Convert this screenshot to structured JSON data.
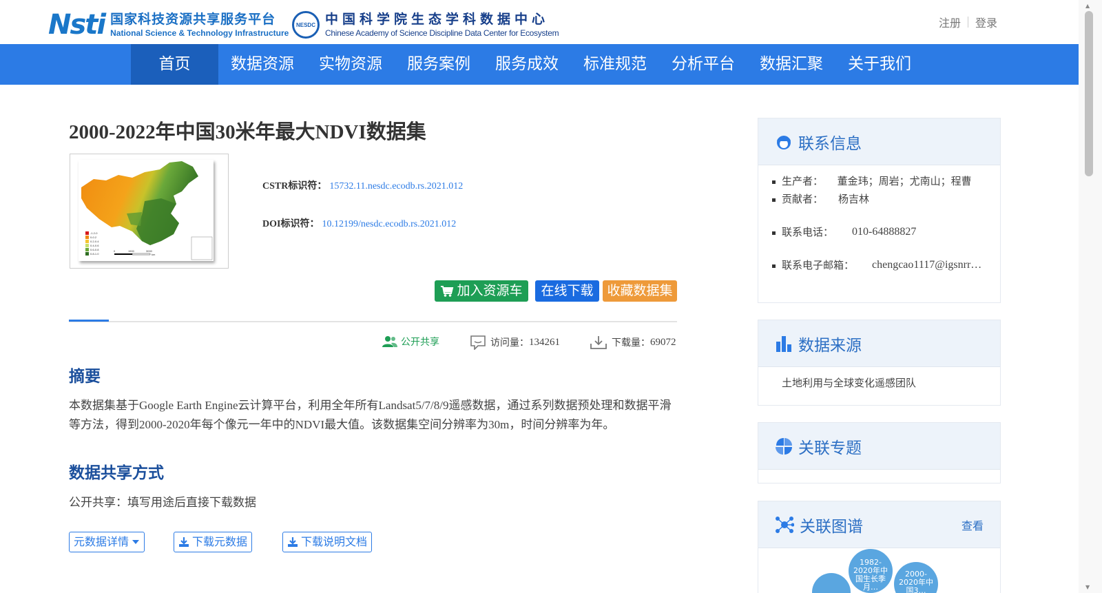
{
  "header": {
    "logo1": {
      "mark": "Nsti",
      "cn": "国家科技资源共享服务平台",
      "en": "National Science & Technology Infrastructure"
    },
    "logo2": {
      "badge": "NESDC",
      "cn": "中国科学院生态学科数据中心",
      "en": "Chinese Academy of Science Discipline Data Center for Ecosystem"
    },
    "register": "注册",
    "login": "登录"
  },
  "nav": {
    "items": [
      "首页",
      "数据资源",
      "实物资源",
      "服务案例",
      "服务成效",
      "标准规范",
      "分析平台",
      "数据汇聚",
      "关于我们"
    ],
    "active_index": 0
  },
  "dataset": {
    "title": "2000-2022年中国30米年最大NDVI数据集",
    "cstr_label": "CSTR标识符：",
    "cstr_value": "15732.11.nesdc.ecodb.rs.2021.012",
    "doi_label": "DOI标识符：",
    "doi_value": "10.12199/nesdc.ecodb.rs.2021.012",
    "thumbnail_legend": [
      "-1.2-0",
      "0-0.2",
      "0.2-0.4",
      "0.4-0.6",
      "0.6-0.8",
      "0.8-1.0"
    ],
    "thumbnail_scale": [
      "0",
      "1500",
      "3000",
      "km"
    ]
  },
  "actions": {
    "add_cart": "加入资源车",
    "download_online": "在线下载",
    "favorite": "收藏数据集"
  },
  "stats": {
    "share_label": "公开共享",
    "views_label": "访问量：",
    "views": "134261",
    "downloads_label": "下载量：",
    "downloads": "69072"
  },
  "abstract": {
    "heading": "摘要",
    "text": "本数据集基于Google Earth Engine云计算平台，利用全年所有Landsat5/7/8/9遥感数据，通过系列数据预处理和数据平滑等方法，得到2000-2020年每个像元一年中的NDVI最大值。该数据集空间分辨率为30m，时间分辨率为年。"
  },
  "sharing": {
    "heading": "数据共享方式",
    "text": "公开共享：填写用途后直接下载数据"
  },
  "doc_buttons": {
    "metadata_detail": "元数据详情",
    "download_metadata": "下载元数据",
    "download_doc": "下载说明文档"
  },
  "sidebar": {
    "contact": {
      "title": "联系信息",
      "producer_label": "生产者：",
      "producer": "董金玮；周岩；尤南山；程曹",
      "contributor_label": "贡献者：",
      "contributor": "杨吉林",
      "phone_label": "联系电话：",
      "phone": "010-64888827",
      "email_label": "联系电子邮箱：",
      "email": "chengcao1117@igsnrr…"
    },
    "source": {
      "title": "数据来源",
      "text": "土地利用与全球变化遥感团队"
    },
    "topics": {
      "title": "关联专题"
    },
    "graph": {
      "title": "关联图谱",
      "more": "查看",
      "nodes": [
        "1982-2020年中国生长季月…",
        "2000-2020年中国3…"
      ]
    }
  },
  "colors": {
    "nav_bg": "#2c7be5",
    "nav_active": "#1b5fbb",
    "green": "#1e9e55",
    "blue": "#1a6be0",
    "orange": "#ee9a3a",
    "link": "#2c7be5"
  }
}
